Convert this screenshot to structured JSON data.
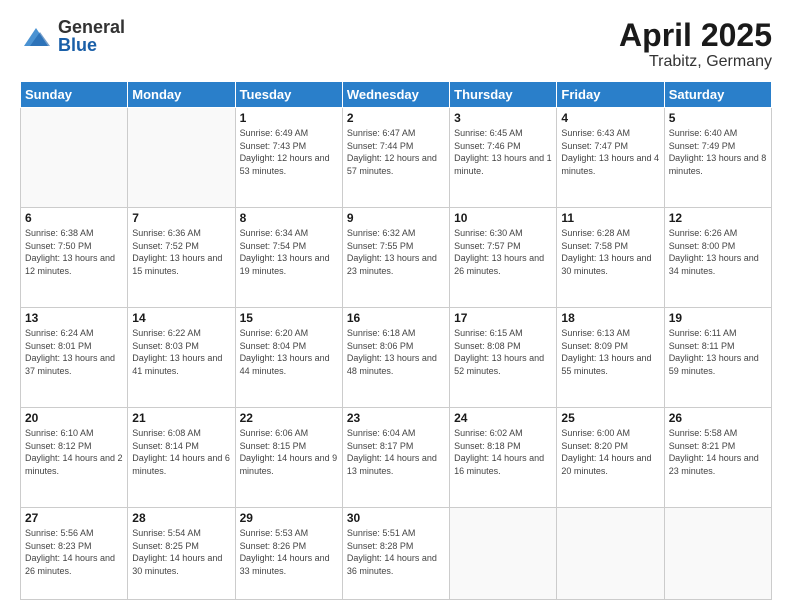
{
  "logo": {
    "general": "General",
    "blue": "Blue"
  },
  "title": "April 2025",
  "subtitle": "Trabitz, Germany",
  "days_of_week": [
    "Sunday",
    "Monday",
    "Tuesday",
    "Wednesday",
    "Thursday",
    "Friday",
    "Saturday"
  ],
  "weeks": [
    [
      {
        "day": "",
        "info": ""
      },
      {
        "day": "",
        "info": ""
      },
      {
        "day": "1",
        "info": "Sunrise: 6:49 AM\nSunset: 7:43 PM\nDaylight: 12 hours and 53 minutes."
      },
      {
        "day": "2",
        "info": "Sunrise: 6:47 AM\nSunset: 7:44 PM\nDaylight: 12 hours and 57 minutes."
      },
      {
        "day": "3",
        "info": "Sunrise: 6:45 AM\nSunset: 7:46 PM\nDaylight: 13 hours and 1 minute."
      },
      {
        "day": "4",
        "info": "Sunrise: 6:43 AM\nSunset: 7:47 PM\nDaylight: 13 hours and 4 minutes."
      },
      {
        "day": "5",
        "info": "Sunrise: 6:40 AM\nSunset: 7:49 PM\nDaylight: 13 hours and 8 minutes."
      }
    ],
    [
      {
        "day": "6",
        "info": "Sunrise: 6:38 AM\nSunset: 7:50 PM\nDaylight: 13 hours and 12 minutes."
      },
      {
        "day": "7",
        "info": "Sunrise: 6:36 AM\nSunset: 7:52 PM\nDaylight: 13 hours and 15 minutes."
      },
      {
        "day": "8",
        "info": "Sunrise: 6:34 AM\nSunset: 7:54 PM\nDaylight: 13 hours and 19 minutes."
      },
      {
        "day": "9",
        "info": "Sunrise: 6:32 AM\nSunset: 7:55 PM\nDaylight: 13 hours and 23 minutes."
      },
      {
        "day": "10",
        "info": "Sunrise: 6:30 AM\nSunset: 7:57 PM\nDaylight: 13 hours and 26 minutes."
      },
      {
        "day": "11",
        "info": "Sunrise: 6:28 AM\nSunset: 7:58 PM\nDaylight: 13 hours and 30 minutes."
      },
      {
        "day": "12",
        "info": "Sunrise: 6:26 AM\nSunset: 8:00 PM\nDaylight: 13 hours and 34 minutes."
      }
    ],
    [
      {
        "day": "13",
        "info": "Sunrise: 6:24 AM\nSunset: 8:01 PM\nDaylight: 13 hours and 37 minutes."
      },
      {
        "day": "14",
        "info": "Sunrise: 6:22 AM\nSunset: 8:03 PM\nDaylight: 13 hours and 41 minutes."
      },
      {
        "day": "15",
        "info": "Sunrise: 6:20 AM\nSunset: 8:04 PM\nDaylight: 13 hours and 44 minutes."
      },
      {
        "day": "16",
        "info": "Sunrise: 6:18 AM\nSunset: 8:06 PM\nDaylight: 13 hours and 48 minutes."
      },
      {
        "day": "17",
        "info": "Sunrise: 6:15 AM\nSunset: 8:08 PM\nDaylight: 13 hours and 52 minutes."
      },
      {
        "day": "18",
        "info": "Sunrise: 6:13 AM\nSunset: 8:09 PM\nDaylight: 13 hours and 55 minutes."
      },
      {
        "day": "19",
        "info": "Sunrise: 6:11 AM\nSunset: 8:11 PM\nDaylight: 13 hours and 59 minutes."
      }
    ],
    [
      {
        "day": "20",
        "info": "Sunrise: 6:10 AM\nSunset: 8:12 PM\nDaylight: 14 hours and 2 minutes."
      },
      {
        "day": "21",
        "info": "Sunrise: 6:08 AM\nSunset: 8:14 PM\nDaylight: 14 hours and 6 minutes."
      },
      {
        "day": "22",
        "info": "Sunrise: 6:06 AM\nSunset: 8:15 PM\nDaylight: 14 hours and 9 minutes."
      },
      {
        "day": "23",
        "info": "Sunrise: 6:04 AM\nSunset: 8:17 PM\nDaylight: 14 hours and 13 minutes."
      },
      {
        "day": "24",
        "info": "Sunrise: 6:02 AM\nSunset: 8:18 PM\nDaylight: 14 hours and 16 minutes."
      },
      {
        "day": "25",
        "info": "Sunrise: 6:00 AM\nSunset: 8:20 PM\nDaylight: 14 hours and 20 minutes."
      },
      {
        "day": "26",
        "info": "Sunrise: 5:58 AM\nSunset: 8:21 PM\nDaylight: 14 hours and 23 minutes."
      }
    ],
    [
      {
        "day": "27",
        "info": "Sunrise: 5:56 AM\nSunset: 8:23 PM\nDaylight: 14 hours and 26 minutes."
      },
      {
        "day": "28",
        "info": "Sunrise: 5:54 AM\nSunset: 8:25 PM\nDaylight: 14 hours and 30 minutes."
      },
      {
        "day": "29",
        "info": "Sunrise: 5:53 AM\nSunset: 8:26 PM\nDaylight: 14 hours and 33 minutes."
      },
      {
        "day": "30",
        "info": "Sunrise: 5:51 AM\nSunset: 8:28 PM\nDaylight: 14 hours and 36 minutes."
      },
      {
        "day": "",
        "info": ""
      },
      {
        "day": "",
        "info": ""
      },
      {
        "day": "",
        "info": ""
      }
    ]
  ]
}
